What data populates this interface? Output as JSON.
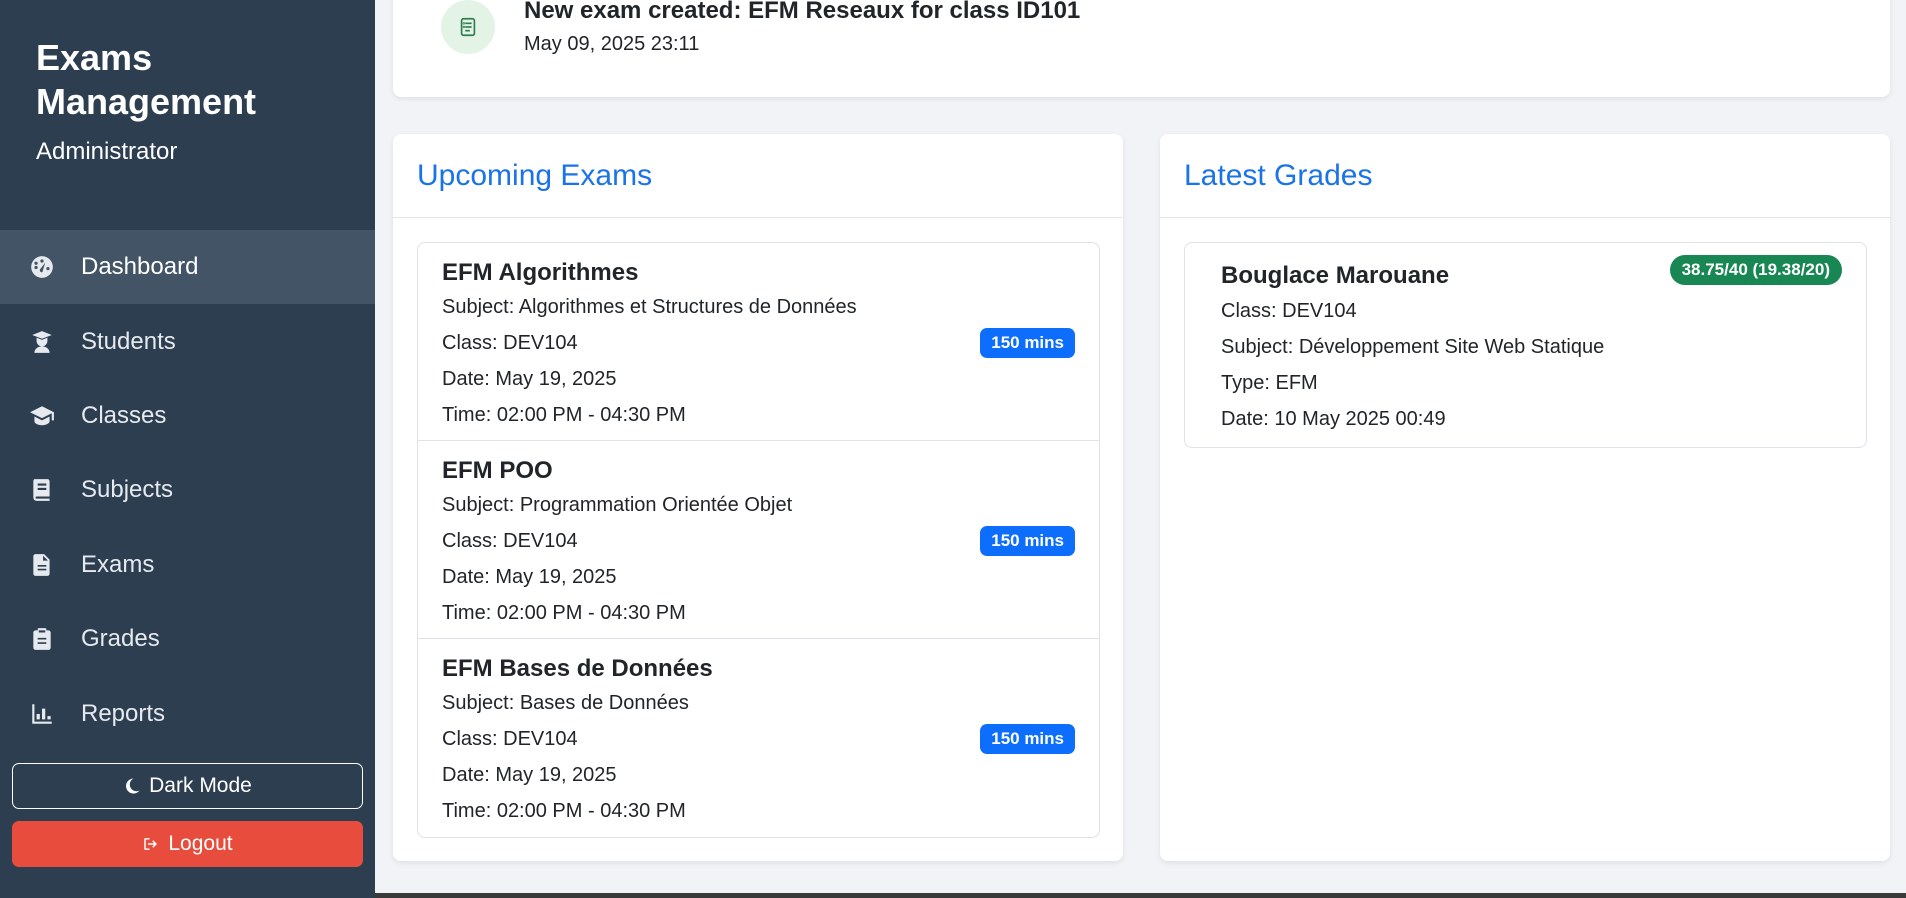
{
  "sidebar": {
    "brand_title": "Exams Management",
    "role": "Administrator",
    "items": [
      {
        "label": "Dashboard",
        "icon": "dashboard-gauge-icon",
        "active": true
      },
      {
        "label": "Students",
        "icon": "student-icon"
      },
      {
        "label": "Classes",
        "icon": "graduation-cap-icon"
      },
      {
        "label": "Subjects",
        "icon": "book-icon"
      },
      {
        "label": "Exams",
        "icon": "file-document-icon"
      },
      {
        "label": "Grades",
        "icon": "clipboard-icon"
      },
      {
        "label": "Reports",
        "icon": "bar-chart-icon"
      }
    ],
    "dark_mode_label": "Dark Mode",
    "logout_label": "Logout"
  },
  "activity": {
    "title": "New exam created: EFM Reseaux for class ID101",
    "time": "May 09, 2025 23:11",
    "icon": "document-list-icon"
  },
  "upcoming": {
    "title": "Upcoming Exams",
    "exams": [
      {
        "name": "EFM Algorithmes",
        "subject": "Subject: Algorithmes et Structures de Données",
        "class": "Class: DEV104",
        "date": "Date: May 19, 2025",
        "time": "Time: 02:00 PM - 04:30 PM",
        "duration": "150 mins"
      },
      {
        "name": "EFM POO",
        "subject": "Subject: Programmation Orientée Objet",
        "class": "Class: DEV104",
        "date": "Date: May 19, 2025",
        "time": "Time: 02:00 PM - 04:30 PM",
        "duration": "150 mins"
      },
      {
        "name": "EFM Bases de Données",
        "subject": "Subject: Bases de Données",
        "class": "Class: DEV104",
        "date": "Date: May 19, 2025",
        "time": "Time: 02:00 PM - 04:30 PM",
        "duration": "150 mins"
      }
    ]
  },
  "grades": {
    "title": "Latest Grades",
    "items": [
      {
        "student": "Bouglace Marouane",
        "class": "Class: DEV104",
        "subject": "Subject: Développement Site Web Statique",
        "type": "Type: EFM",
        "date": "Date: 10 May 2025 00:49",
        "score": "38.75/40 (19.38/20)"
      }
    ]
  },
  "colors": {
    "sidebar_bg": "#2c3e50",
    "accent_blue": "#1a73e8",
    "badge_blue": "#0d6efd",
    "badge_green": "#198754",
    "logout_red": "#e74c3c"
  }
}
